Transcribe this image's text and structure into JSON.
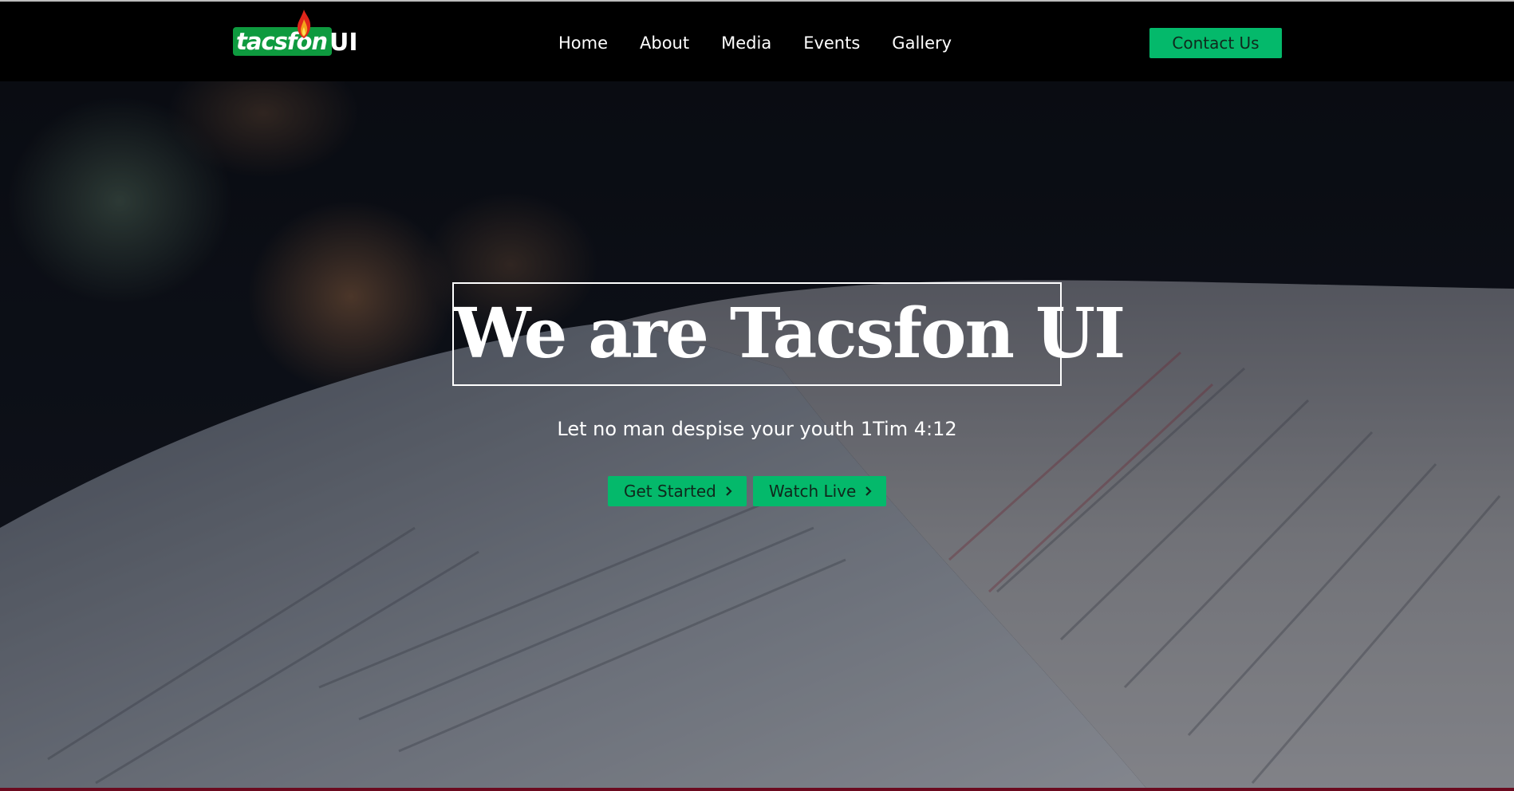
{
  "header": {
    "logo": {
      "wordmark": "tacsfon",
      "suffix": "UI",
      "icon": "flame-icon",
      "brand_green": "#0e9a3f"
    },
    "nav": [
      {
        "label": "Home"
      },
      {
        "label": "About"
      },
      {
        "label": "Media"
      },
      {
        "label": "Events"
      },
      {
        "label": "Gallery"
      }
    ],
    "contact_label": "Contact Us"
  },
  "hero": {
    "title": "We are Tacsfon UI",
    "subtitle": "Let no man despise your youth 1Tim 4:12",
    "buttons": [
      {
        "label": "Get Started",
        "icon": "chevron-right-icon"
      },
      {
        "label": "Watch Live",
        "icon": "chevron-right-icon"
      }
    ],
    "background": "open-bible-photo"
  },
  "colors": {
    "accent": "#04b96b",
    "navbar_bg": "#000000",
    "text_light": "#ffffff",
    "bottom_border": "#6b0a1f"
  }
}
